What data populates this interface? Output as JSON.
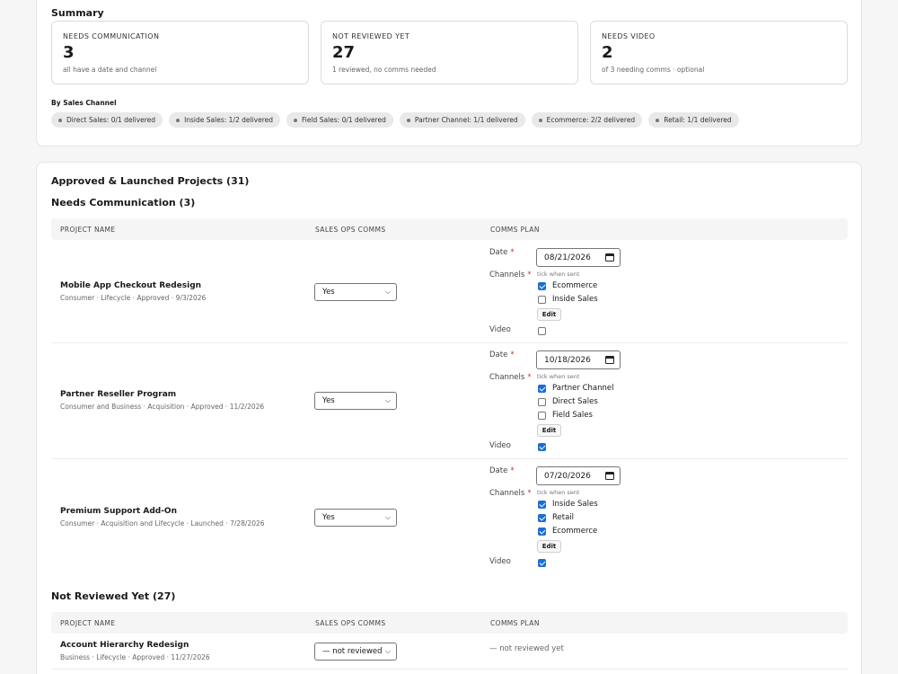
{
  "summary": {
    "title": "Summary",
    "stats": [
      {
        "label": "NEEDS COMMUNICATION",
        "value": "3",
        "note": "all have a date and channel"
      },
      {
        "label": "NOT REVIEWED YET",
        "value": "27",
        "note": "1 reviewed, no comms needed"
      },
      {
        "label": "NEEDS VIDEO",
        "value": "2",
        "note": "of 3 needing comms · optional"
      }
    ],
    "by_channel_label": "By Sales Channel",
    "channels": [
      "Direct Sales: 0/1 delivered",
      "Inside Sales: 1/2 delivered",
      "Field Sales: 0/1 delivered",
      "Partner Channel: 1/1 delivered",
      "Ecommerce: 2/2 delivered",
      "Retail: 1/1 delivered"
    ]
  },
  "projects": {
    "title": "Approved & Launched Projects (31)",
    "needs_comm_title": "Needs Communication (3)",
    "not_reviewed_title": "Not Reviewed Yet (27)",
    "columns": {
      "name": "PROJECT NAME",
      "sales": "SALES OPS COMMS",
      "plan": "COMMS PLAN"
    },
    "labels": {
      "date": "Date",
      "channels": "Channels",
      "video": "Video",
      "required": "*",
      "tick_note": "tick when sent",
      "edit": "Edit"
    },
    "needs_comm_rows": [
      {
        "name": "Mobile App Checkout Redesign",
        "meta": "Consumer · Lifecycle · Approved · 9/3/2026",
        "sales_ops": "Yes",
        "date": "08/21/2026",
        "channels": [
          {
            "name": "Ecommerce",
            "checked": true
          },
          {
            "name": "Inside Sales",
            "checked": false
          }
        ],
        "video": false
      },
      {
        "name": "Partner Reseller Program",
        "meta": "Consumer and Business · Acquisition · Approved · 11/2/2026",
        "sales_ops": "Yes",
        "date": "10/18/2026",
        "channels": [
          {
            "name": "Partner Channel",
            "checked": true
          },
          {
            "name": "Direct Sales",
            "checked": false
          },
          {
            "name": "Field Sales",
            "checked": false
          }
        ],
        "video": true
      },
      {
        "name": "Premium Support Add-On",
        "meta": "Consumer · Acquisition and Lifecycle · Launched · 7/28/2026",
        "sales_ops": "Yes",
        "date": "07/20/2026",
        "channels": [
          {
            "name": "Inside Sales",
            "checked": true
          },
          {
            "name": "Retail",
            "checked": true
          },
          {
            "name": "Ecommerce",
            "checked": true
          }
        ],
        "video": true
      }
    ],
    "not_reviewed_rows": [
      {
        "name": "Account Hierarchy Redesign",
        "meta": "Business · Lifecycle · Approved · 11/27/2026",
        "sales_ops": "— not reviewed",
        "plan": "— not reviewed yet"
      }
    ]
  },
  "colors": {
    "accent": "#1a6fd6",
    "required": "#c0392b",
    "pill_bg": "#e9e9e9"
  }
}
